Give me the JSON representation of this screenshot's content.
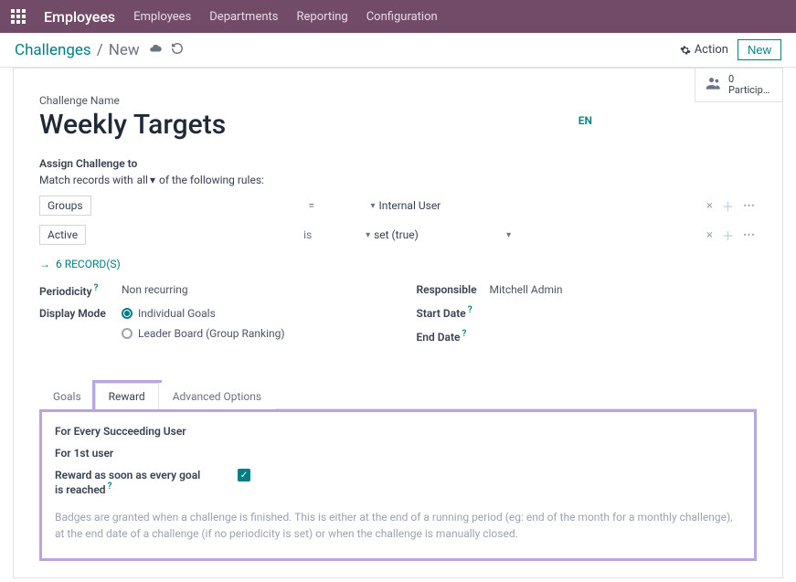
{
  "topbar": {
    "brand": "Employees",
    "menu": [
      "Employees",
      "Departments",
      "Reporting",
      "Configuration"
    ]
  },
  "controlbar": {
    "breadcrumb_root": "Challenges",
    "breadcrumb_current": "New",
    "action_label": "Action",
    "new_label": "New"
  },
  "stat": {
    "count": "0",
    "label": "Participa…"
  },
  "form": {
    "name_label": "Challenge Name",
    "name_value": "Weekly Targets",
    "lang": "EN",
    "assign_label": "Assign Challenge to",
    "match_prefix": "Match records with",
    "match_mode": "all",
    "match_suffix": "of the following rules:",
    "rules": [
      {
        "field": "Groups",
        "op": "=",
        "value": "Internal User",
        "val_caret": true
      },
      {
        "field": "Active",
        "op": "is",
        "value": "set (true)",
        "val_caret": true,
        "extra_caret": true
      }
    ],
    "records_link": "6 RECORD(S)",
    "left": {
      "periodicity_label": "Periodicity",
      "periodicity_value": "Non recurring",
      "display_mode_label": "Display Mode",
      "display_options": {
        "individual": "Individual Goals",
        "leaderboard": "Leader Board (Group Ranking)"
      }
    },
    "right": {
      "responsible_label": "Responsible",
      "responsible_value": "Mitchell Admin",
      "start_label": "Start Date",
      "end_label": "End Date"
    }
  },
  "tabs": {
    "goals": "Goals",
    "reward": "Reward",
    "advanced": "Advanced Options"
  },
  "reward": {
    "every_user": "For Every Succeeding User",
    "first_user": "For 1st user",
    "asap_label": "Reward as soon as every goal is reached",
    "note": "Badges are granted when a challenge is finished. This is either at the end of a running period (eg: end of the month for a monthly challenge), at the end date of a challenge (if no periodicity is set) or when the challenge is manually closed."
  }
}
